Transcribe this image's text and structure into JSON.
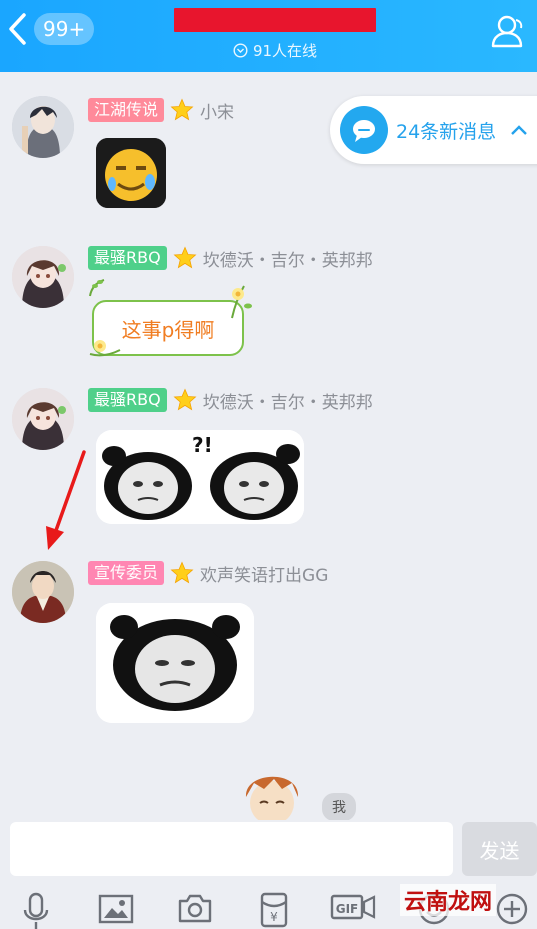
{
  "header": {
    "unread_badge": "99+",
    "online_count": "91人在线"
  },
  "new_messages": {
    "label": "24条新消息"
  },
  "messages": [
    {
      "tag": "江湖传说",
      "nickname": "小宋"
    },
    {
      "tag": "最骚RBQ",
      "nickname": "坎德沃・吉尔・英邦邦",
      "text": "这事p得啊"
    },
    {
      "tag": "最骚RBQ",
      "nickname": "坎德沃・吉尔・英邦邦"
    },
    {
      "tag": "宣传委员",
      "nickname": "欢声笑语打出GG"
    }
  ],
  "sticker_text": "?!",
  "me_label": "我",
  "input": {
    "placeholder": "",
    "send_label": "发送"
  },
  "toolbar": {
    "items": [
      "mic-icon",
      "image-icon",
      "camera-icon",
      "red-packet-icon",
      "gif-icon",
      "emoji-icon",
      "plus-icon"
    ]
  },
  "watermark": "云南龙网",
  "colors": {
    "header": "#1fb0ff",
    "accent": "#25a2ec",
    "tag_pink": "#ff8a9a",
    "tag_green": "#4fd08a",
    "tag_magenta": "#ff86b2"
  }
}
